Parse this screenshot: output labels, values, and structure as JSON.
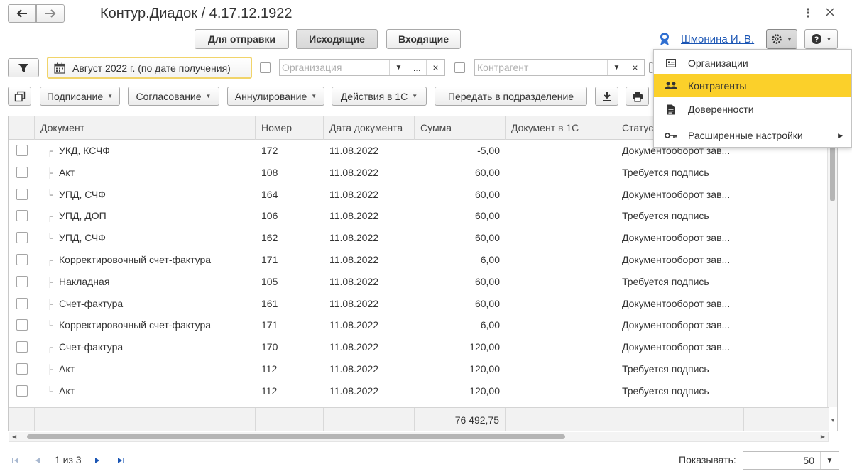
{
  "titlebar": {
    "back_icon": "arrow-left-icon",
    "forward_icon": "arrow-right-icon",
    "title": "Контур.Диадок / 4.17.12.1922",
    "more_icon": "vertical-dots-icon",
    "close_icon": "close-icon"
  },
  "mode_buttons": {
    "outgoing_for_send": "Для отправки",
    "outgoing": "Исходящие",
    "incoming": "Входящие"
  },
  "user": {
    "name": "Шмонина И. В.",
    "icon": "user-badge-icon"
  },
  "filters": {
    "period": "Август 2022 г. (по дате получения)",
    "organization_placeholder": "Организация",
    "counterparty_placeholder": "Контрагент",
    "dots": "...",
    "clear": "×"
  },
  "actions": {
    "signing": "Подписание",
    "approval": "Согласование",
    "cancellation": "Аннулирование",
    "actions_1c": "Действия в 1С",
    "transfer": "Передать в подразделение"
  },
  "table": {
    "columns": [
      "Документ",
      "Номер",
      "Дата документа",
      "Сумма",
      "Документ в 1С",
      "Статус"
    ],
    "rows": [
      {
        "tree": "┌",
        "doc": "УКД, КСЧФ",
        "number": "172",
        "date": "11.08.2022",
        "sum": "-5,00",
        "doc1c": "",
        "status": "Документооборот зав..."
      },
      {
        "tree": "├",
        "doc": "Акт",
        "number": "108",
        "date": "11.08.2022",
        "sum": "60,00",
        "doc1c": "",
        "status": "Требуется подпись"
      },
      {
        "tree": "└",
        "doc": "УПД, СЧФ",
        "number": "164",
        "date": "11.08.2022",
        "sum": "60,00",
        "doc1c": "",
        "status": "Документооборот зав..."
      },
      {
        "tree": "┌",
        "doc": "УПД, ДОП",
        "number": "106",
        "date": "11.08.2022",
        "sum": "60,00",
        "doc1c": "",
        "status": "Требуется подпись"
      },
      {
        "tree": "└",
        "doc": "УПД, СЧФ",
        "number": "162",
        "date": "11.08.2022",
        "sum": "60,00",
        "doc1c": "",
        "status": "Документооборот зав..."
      },
      {
        "tree": "┌",
        "doc": "Корректировочный счет-фактура",
        "number": "171",
        "date": "11.08.2022",
        "sum": "6,00",
        "doc1c": "",
        "status": "Документооборот зав..."
      },
      {
        "tree": "├",
        "doc": "Накладная",
        "number": "105",
        "date": "11.08.2022",
        "sum": "60,00",
        "doc1c": "",
        "status": "Требуется подпись"
      },
      {
        "tree": "├",
        "doc": "Счет-фактура",
        "number": "161",
        "date": "11.08.2022",
        "sum": "60,00",
        "doc1c": "",
        "status": "Документооборот зав..."
      },
      {
        "tree": "└",
        "doc": "Корректировочный счет-фактура",
        "number": "171",
        "date": "11.08.2022",
        "sum": "6,00",
        "doc1c": "",
        "status": "Документооборот зав..."
      },
      {
        "tree": "┌",
        "doc": "Счет-фактура",
        "number": "170",
        "date": "11.08.2022",
        "sum": "120,00",
        "doc1c": "",
        "status": "Документооборот зав..."
      },
      {
        "tree": "├",
        "doc": "Акт",
        "number": "112",
        "date": "11.08.2022",
        "sum": "120,00",
        "doc1c": "",
        "status": "Требуется подпись"
      },
      {
        "tree": "└",
        "doc": "Акт",
        "number": "112",
        "date": "11.08.2022",
        "sum": "120,00",
        "doc1c": "",
        "status": "Требуется подпись"
      }
    ],
    "total_sum": "76 492,75"
  },
  "menu": {
    "items": [
      {
        "label": "Организации",
        "icon": "organization-card-icon",
        "active": false
      },
      {
        "label": "Контрагенты",
        "icon": "users-group-icon",
        "active": true
      },
      {
        "label": "Доверенности",
        "icon": "document-icon",
        "active": false
      },
      {
        "label": "Расширенные настройки",
        "icon": "key-icon",
        "active": false,
        "submenu": true
      }
    ]
  },
  "pagination": {
    "page_text": "1 из 3",
    "show_label": "Показывать:",
    "page_size": "50"
  },
  "colors": {
    "accent": "#fbd02a",
    "link": "#1a55b4"
  }
}
